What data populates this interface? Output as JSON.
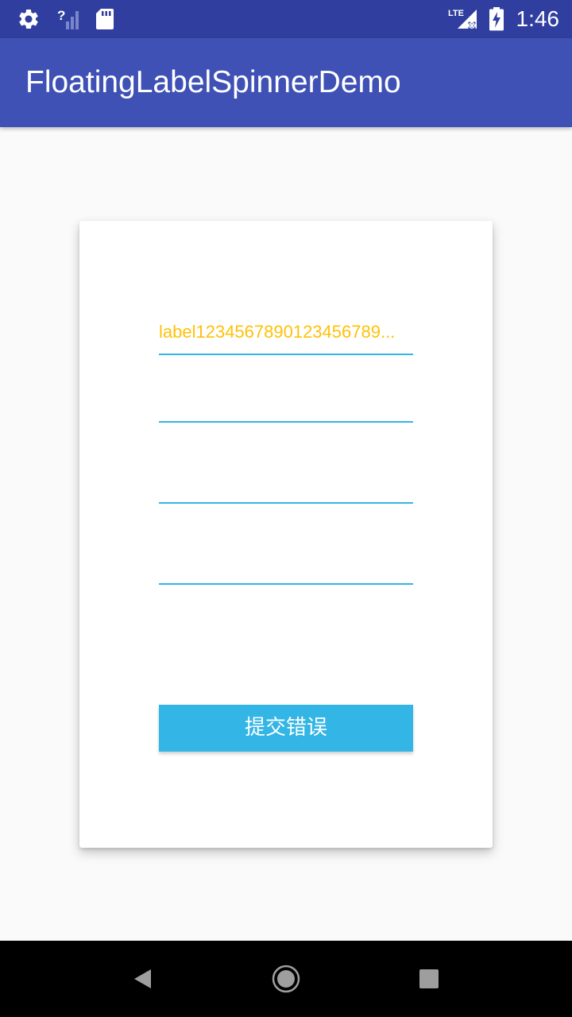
{
  "status_bar": {
    "time": "1:46",
    "network_label": "LTE",
    "icons": [
      "settings-icon",
      "no-signal-icon",
      "sd-card-icon",
      "lte-signal-icon",
      "battery-charging-icon"
    ]
  },
  "app_bar": {
    "title": "FloatingLabelSpinnerDemo",
    "color": "#3f51b5",
    "status_color": "#303f9f"
  },
  "form": {
    "spinners": [
      {
        "label": "label1234567890123456789..."
      },
      {
        "label": ""
      },
      {
        "label": ""
      },
      {
        "label": ""
      }
    ],
    "submit_label": "提交错误",
    "accent_color": "#33b5e5",
    "label_color": "#ffc107"
  },
  "nav_bar": {
    "buttons": [
      "back-icon",
      "home-icon",
      "recents-icon"
    ]
  }
}
